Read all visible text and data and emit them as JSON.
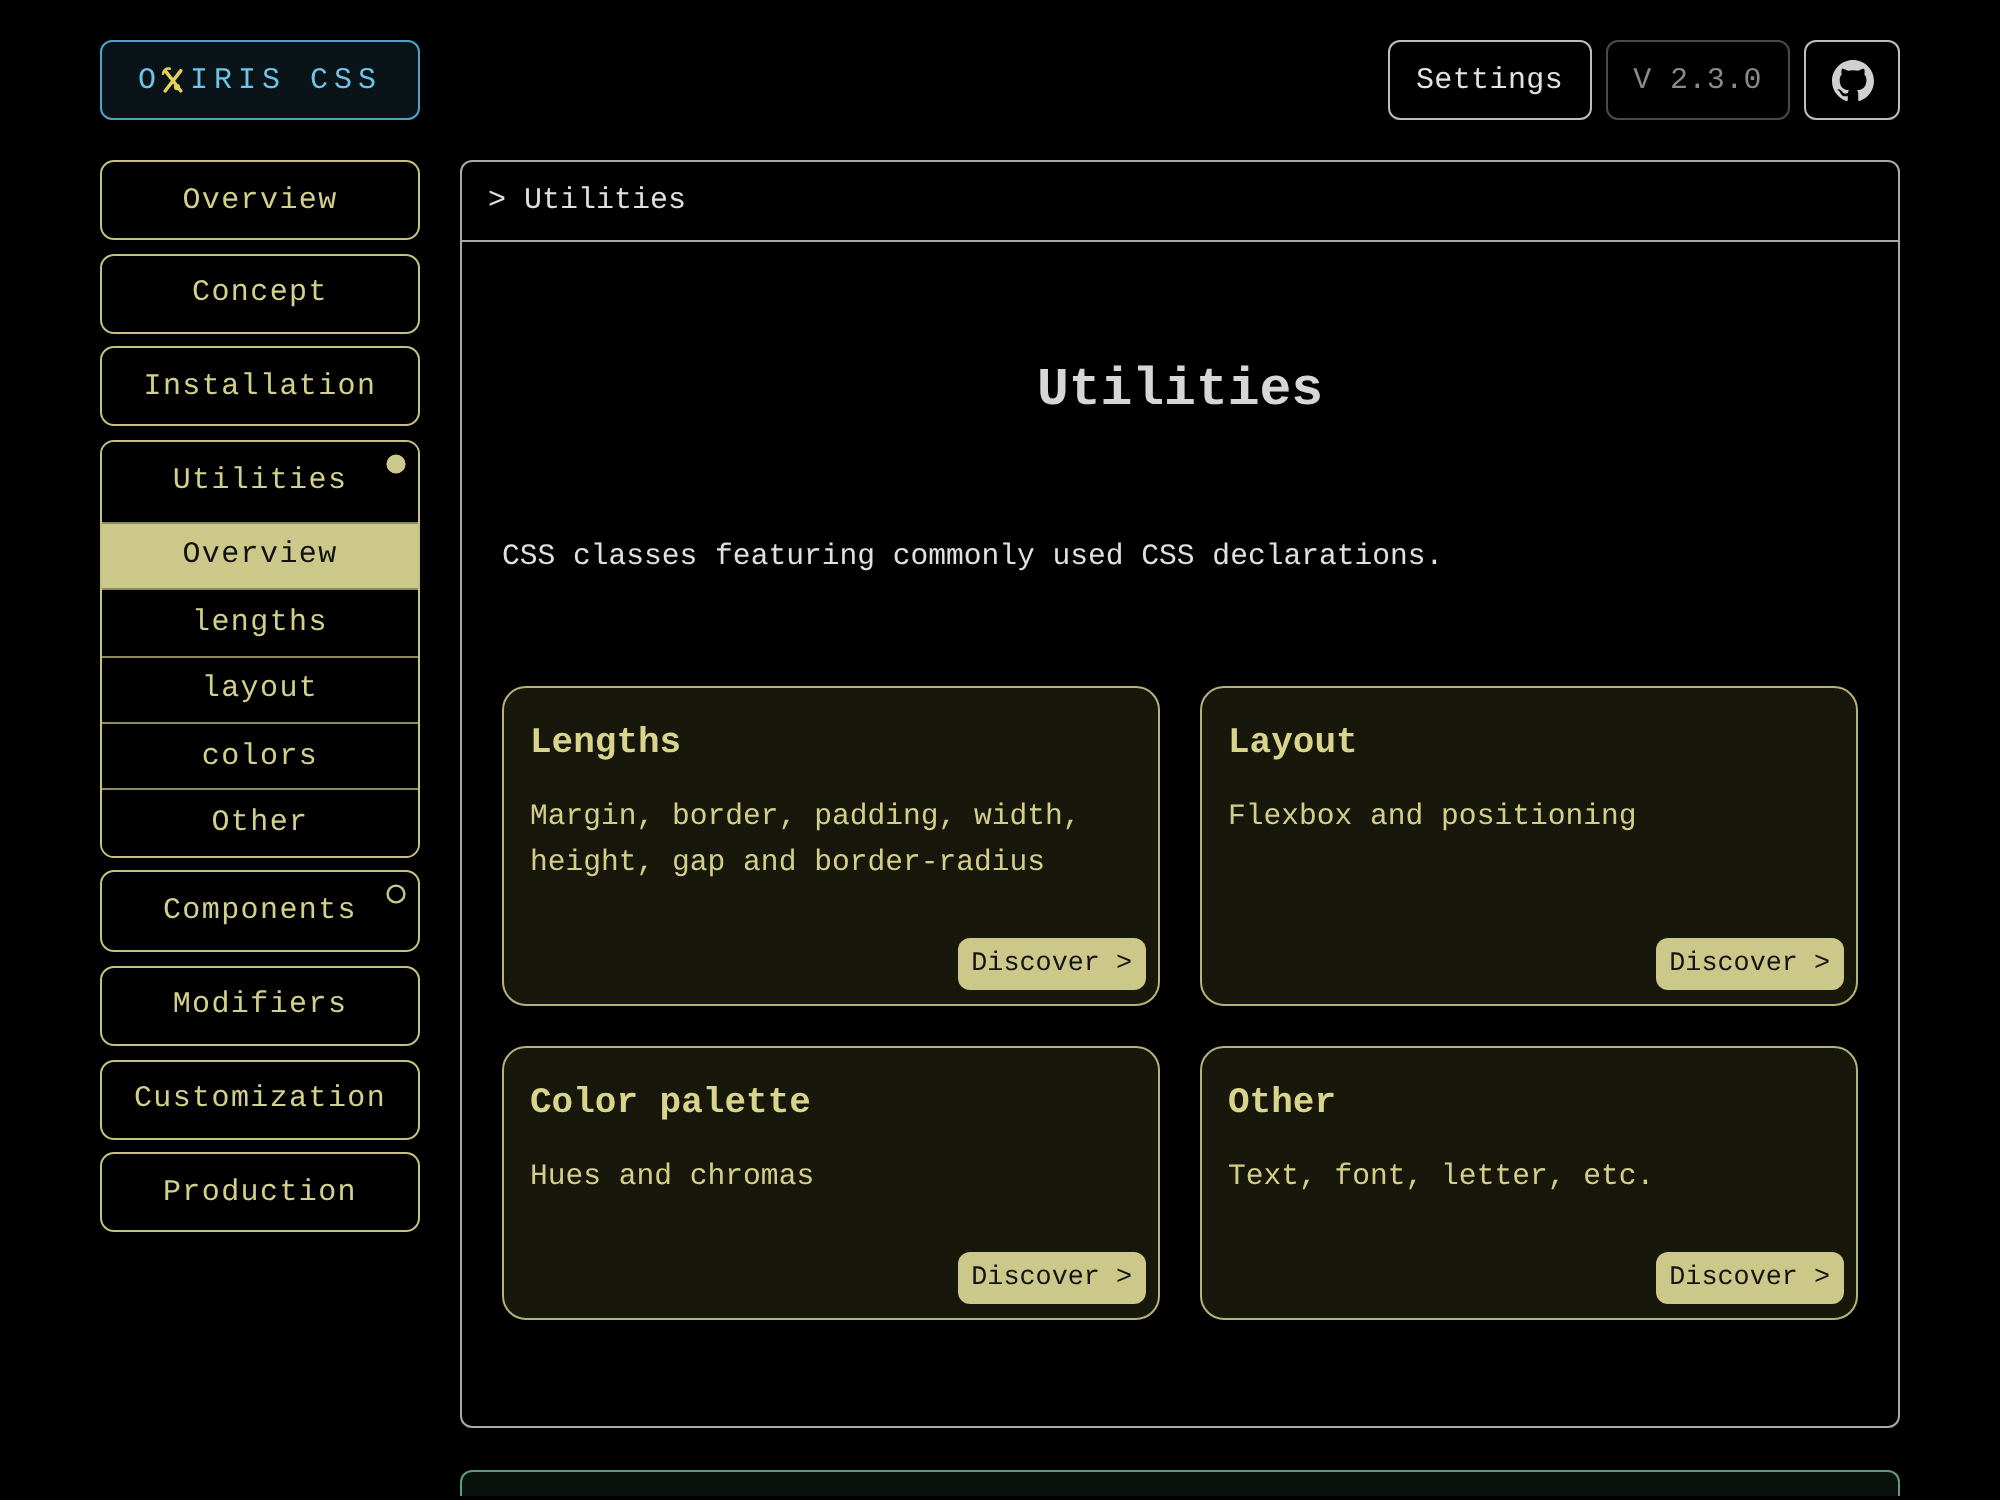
{
  "header": {
    "logo": {
      "before_icon": "O",
      "after_icon": "IRIS CSS"
    },
    "settings": "Settings",
    "version": "V 2.3.0"
  },
  "sidebar": {
    "items": [
      {
        "kind": "link",
        "label": "Overview"
      },
      {
        "kind": "link",
        "label": "Concept"
      },
      {
        "kind": "link",
        "label": "Installation"
      },
      {
        "kind": "group",
        "label": "Utilities",
        "expanded": true,
        "children": [
          {
            "label": "Overview",
            "selected": true
          },
          {
            "label": "lengths",
            "selected": false
          },
          {
            "label": "layout",
            "selected": false
          },
          {
            "label": "colors",
            "selected": false
          },
          {
            "label": "Other",
            "selected": false
          }
        ]
      },
      {
        "kind": "group",
        "label": "Components",
        "expanded": false
      },
      {
        "kind": "link",
        "label": "Modifiers"
      },
      {
        "kind": "link",
        "label": "Customization"
      },
      {
        "kind": "link",
        "label": "Production"
      }
    ]
  },
  "main": {
    "breadcrumb": "> Utilities",
    "title": "Utilities",
    "description": "CSS classes featuring commonly used CSS declarations.",
    "cards": [
      {
        "title": "Lengths",
        "description": "Margin, border, padding, width, height, gap and border-radius",
        "button": "Discover >"
      },
      {
        "title": "Layout",
        "description": "Flexbox and positioning",
        "button": "Discover >"
      },
      {
        "title": "Color palette",
        "description": "Hues and chromas",
        "button": "Discover >"
      },
      {
        "title": "Other",
        "description": "Text, font, letter, etc.",
        "button": "Discover >"
      }
    ]
  }
}
